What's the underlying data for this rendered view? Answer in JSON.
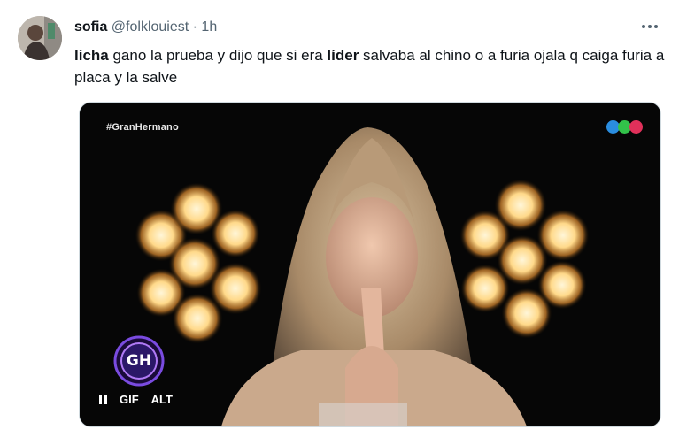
{
  "tweet": {
    "display_name": "sofia",
    "handle": "@folklouiest",
    "separator": "·",
    "time": "1h",
    "text_parts": [
      {
        "bold": true,
        "text": "licha"
      },
      {
        "bold": false,
        "text": " gano la prueba y dijo que si era "
      },
      {
        "bold": true,
        "text": "líder"
      },
      {
        "bold": false,
        "text": " salvaba al chino o a furia ojala q caiga furia a placa y la salve"
      }
    ]
  },
  "media": {
    "hashtag": "#GranHermano",
    "badge_letters": "GH",
    "controls": {
      "gif_label": "GIF",
      "alt_label": "ALT"
    },
    "channel_colors": [
      "#2a8de0",
      "#32c24a",
      "#e0305a"
    ]
  },
  "icons": {
    "more": "more-horizontal-icon",
    "pause": "pause-icon"
  }
}
